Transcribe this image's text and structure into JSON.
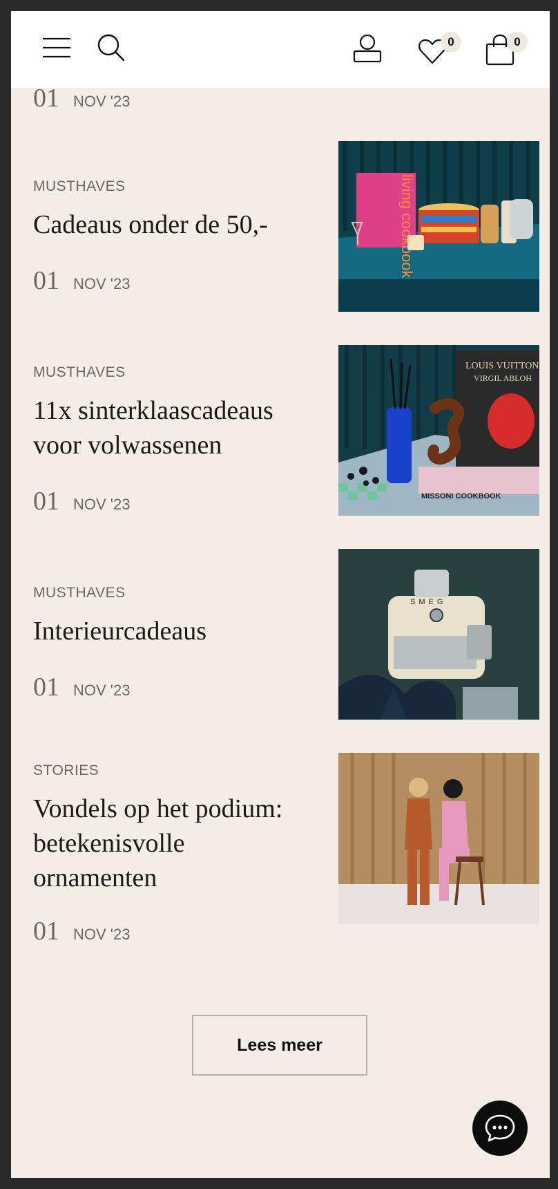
{
  "header": {
    "wishlist_count": "0",
    "cart_count": "0"
  },
  "partial_article": {
    "day": "01",
    "month": "NOV '23"
  },
  "articles": [
    {
      "category": "MUSTHAVES",
      "title": "Cadeaus onder de 50,-",
      "day": "01",
      "month": "NOV '23"
    },
    {
      "category": "MUSTHAVES",
      "title": "11x sinterklaascadeaus voor volwassenen",
      "day": "01",
      "month": "NOV '23"
    },
    {
      "category": "MUSTHAVES",
      "title": "Interieurcadeaus",
      "day": "01",
      "month": "NOV '23"
    },
    {
      "category": "STORIES",
      "title": "Vondels op het podium: betekenisvolle ornamenten",
      "day": "01",
      "month": "NOV '23"
    }
  ],
  "images": {
    "cookbook_text": "living cookbook",
    "book_title": "LOUIS VUITTON",
    "book_author": "VIRGIL ABLOH",
    "cookbook2": "MISSONI COOKBOOK",
    "machine_brand": "SMEG"
  },
  "load_more_label": "Lees meer",
  "colors": {
    "page_bg": "#f3ede6",
    "header_bg": "#ffffff",
    "chat_bg": "#0c0c0c"
  }
}
